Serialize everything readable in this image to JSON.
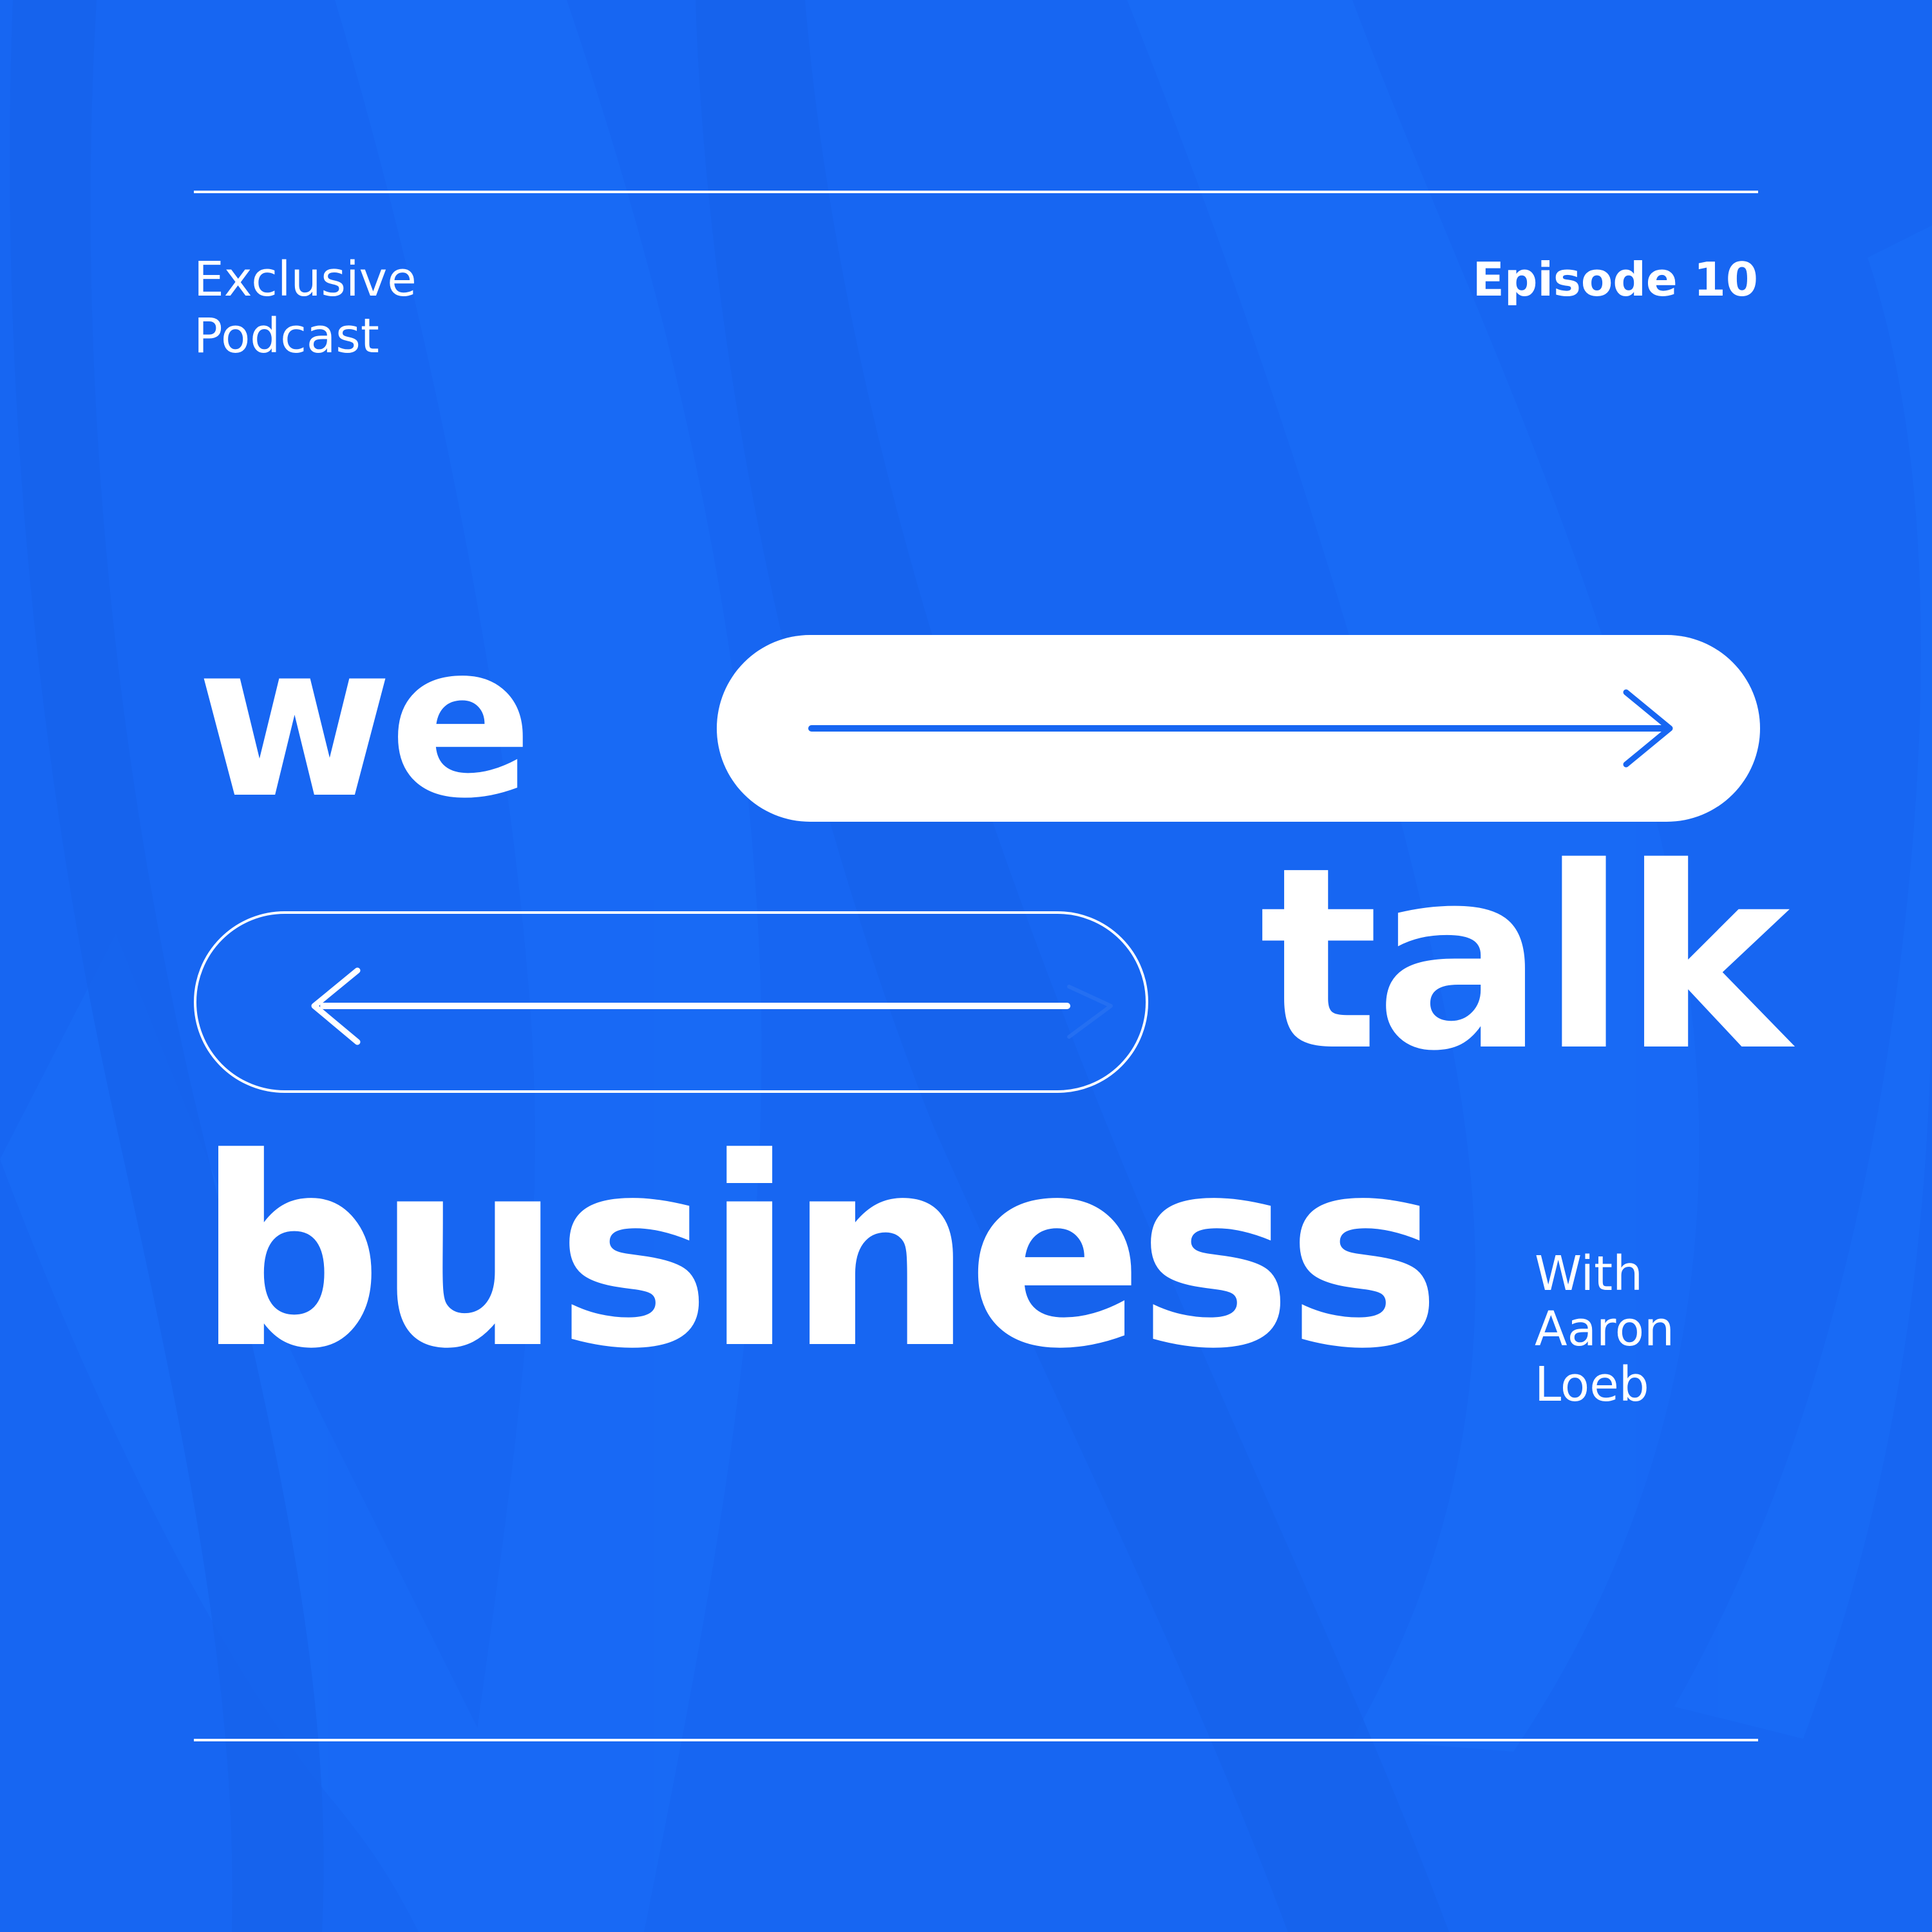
{
  "header": {
    "label_line1": "Exclusive",
    "label_line2": "Podcast",
    "episode": "Episode 10"
  },
  "title": {
    "word1": "we",
    "word2": "talk",
    "word3": "business"
  },
  "host": {
    "line1": "With",
    "line2": "Aaron",
    "line3": "Loeb"
  },
  "colors": {
    "background": "#1766f2",
    "foreground": "#ffffff",
    "accent": "#1766f2"
  },
  "icons": {
    "filled_pill": "arrow-right-icon",
    "outline_pill": "arrow-left-icon"
  }
}
